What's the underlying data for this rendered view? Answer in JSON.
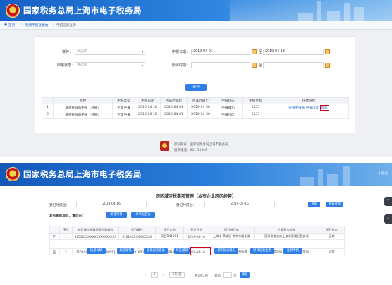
{
  "site_title": "国家税务总局上海市电子税务局",
  "s1": {
    "breadcrumb": [
      "首页",
      "税费申报及缴纳",
      "申报信息查询"
    ],
    "form": {
      "tax_type_label": "税种：",
      "tax_type_placeholder": "请选择",
      "declare_date_label": "申报日期：",
      "declare_date_from": "2019-04-01",
      "to_label": "至",
      "declare_date_to": "2019-04-18",
      "status_label": "申报状态：",
      "status_placeholder": "请选择",
      "period_label": "所属时期：",
      "period_to_label": "至",
      "search_button": "查询"
    },
    "table": {
      "headers": [
        "",
        "税种",
        "申报类型",
        "申报日期",
        "所属时期起",
        "所属时期止",
        "申报状态",
        "申报金额",
        "快捷链接"
      ],
      "rows": [
        {
          "no": "1",
          "tax": "增值税预缴申报（月报）",
          "type": "正常申报",
          "date": "2019-04-18",
          "start": "2019-04-01",
          "end": "2019-04-30",
          "status": "申报成功",
          "amount": "6233",
          "links": [
            "查看申报表",
            "申报作废"
          ],
          "boxed": "缴款"
        },
        {
          "no": "2",
          "tax": "增值税预缴申报（月报）",
          "type": "正常申报",
          "date": "2019-04-18",
          "start": "2019-04-01",
          "end": "2019-04-30",
          "status": "申报作废",
          "amount": "6233",
          "links": [],
          "boxed": ""
        }
      ]
    },
    "footer": {
      "line1": "版权所有：国家税务总局上海市税务局",
      "line2": "服务电话：021-12366"
    }
  },
  "s2": {
    "bar_links": "| 退出",
    "page_title": "跨区域涉税事项管理（本市企业跨区经营）",
    "reg_from_label": "登记时间起：",
    "reg_from": "2019-04-16",
    "reg_to_label": "登记时间止：",
    "reg_to": "2019-04-16",
    "btn_query": "查询",
    "btn_reset": "重置查询",
    "new_label": "若有新的项目，请点击：",
    "btn_new": "新建项目",
    "btn_report": "事项报告表",
    "table": {
      "headers": [
        "",
        "序号",
        "跨区域涉税事项报告表编号",
        "项目编号",
        "项目名称",
        "登记日期",
        "项目所在地",
        "主管税务机关",
        "项目状态"
      ],
      "rows": [
        {
          "no": "1",
          "report_no": "3101XXXXXXXXXXXXXXXXX",
          "proj_no": "3101XXXXXXXXXXX",
          "proj_name": "项目D41901",
          "reg_date": "2019-04-16",
          "location": "上海市 黄浦区 南京东路街道",
          "office": "国家税务总局上海市黄浦区税务局",
          "status": "正常"
        },
        {
          "no": "2",
          "report_no": "31010420190000016OYOJ",
          "proj_no": "31010420190000024",
          "proj_name": "项目D41901",
          "reg_date": "2019-04-16",
          "location": "上海市 徐汇区 长桥街道",
          "office": "国家税务总局上海市徐汇区税务局",
          "status": "正常"
        }
      ],
      "action_buttons": [
        "信息详情",
        "报验撤销",
        "信息报告修改",
        "跨区撤销",
        "打印报表情况",
        "项目信息变更",
        "注销申报"
      ]
    },
    "pager": {
      "per_page": "5条/页",
      "summary": "共1页2条",
      "goto_label": "到第",
      "page_unit": "页",
      "go_button": "确定",
      "current": "1"
    },
    "side_icons": [
      "?",
      "⌕"
    ]
  }
}
